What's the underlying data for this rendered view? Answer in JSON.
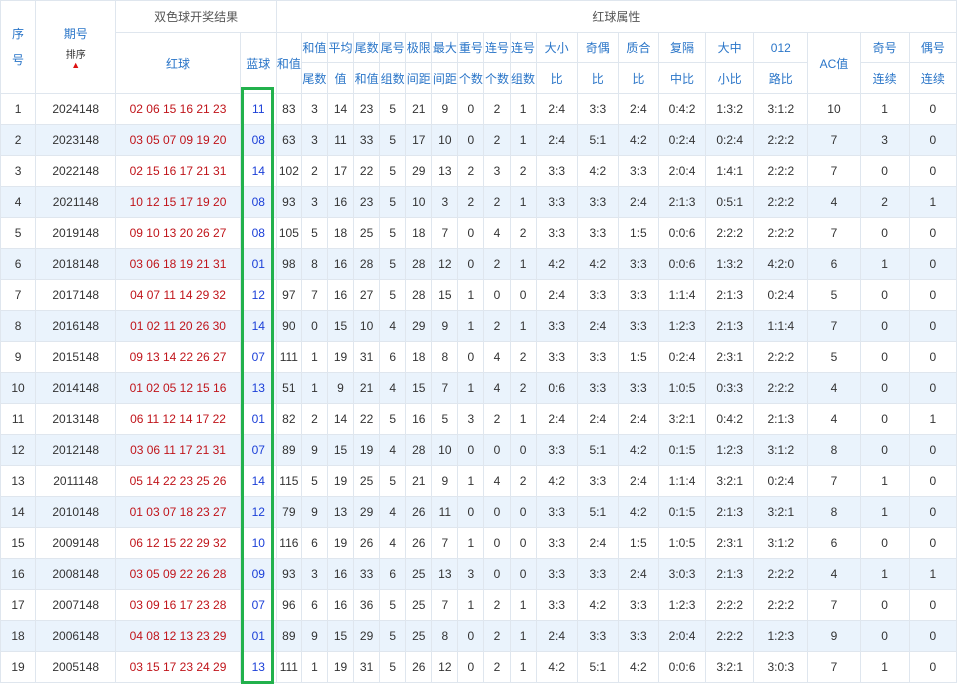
{
  "header": {
    "seq": "序号",
    "period": "期号",
    "sort_label": "排序",
    "group_result": "双色球开奖结果",
    "group_attr": "红球属性",
    "red": "红球",
    "blue": "蓝球",
    "cols": [
      {
        "top": "和值",
        "bottom": "尾数"
      },
      {
        "top": "平均",
        "bottom": "值"
      },
      {
        "top": "尾数",
        "bottom": "和值"
      },
      {
        "top": "尾号",
        "bottom": "组数"
      },
      {
        "top": "极限",
        "bottom": "间距"
      },
      {
        "top": "最大",
        "bottom": "间距"
      },
      {
        "top": "重号",
        "bottom": "个数"
      },
      {
        "top": "连号",
        "bottom": "个数"
      },
      {
        "top": "连号",
        "bottom": "组数"
      },
      {
        "top": "大小",
        "bottom": "比"
      },
      {
        "top": "奇偶",
        "bottom": "比"
      },
      {
        "top": "质合",
        "bottom": "比"
      },
      {
        "top": "复隔",
        "bottom": "中比"
      },
      {
        "top": "大中",
        "bottom": "小比"
      },
      {
        "top": "012",
        "bottom": "路比"
      }
    ],
    "sum": "和值",
    "ac": "AC值",
    "odd_streak": {
      "top": "奇号",
      "bottom": "连续"
    },
    "even_streak": {
      "top": "偶号",
      "bottom": "连续"
    }
  },
  "colors": {
    "red_ball": "#c0141a",
    "blue_ball": "#1b3fd8",
    "header": "#2a75c8",
    "highlight": "#22b14c",
    "row_alt": "#eaf3fc"
  },
  "rows": [
    [
      "1",
      "2024148",
      "02 06 15 16 21 23",
      "11",
      "83",
      "3",
      "14",
      "23",
      "5",
      "21",
      "9",
      "0",
      "2",
      "1",
      "2:4",
      "3:3",
      "2:4",
      "0:4:2",
      "1:3:2",
      "3:1:2",
      "10",
      "1",
      "0"
    ],
    [
      "2",
      "2023148",
      "03 05 07 09 19 20",
      "08",
      "63",
      "3",
      "11",
      "33",
      "5",
      "17",
      "10",
      "0",
      "2",
      "1",
      "2:4",
      "5:1",
      "4:2",
      "0:2:4",
      "0:2:4",
      "2:2:2",
      "7",
      "3",
      "0"
    ],
    [
      "3",
      "2022148",
      "02 15 16 17 21 31",
      "14",
      "102",
      "2",
      "17",
      "22",
      "5",
      "29",
      "13",
      "2",
      "3",
      "2",
      "3:3",
      "4:2",
      "3:3",
      "2:0:4",
      "1:4:1",
      "2:2:2",
      "7",
      "0",
      "0"
    ],
    [
      "4",
      "2021148",
      "10 12 15 17 19 20",
      "08",
      "93",
      "3",
      "16",
      "23",
      "5",
      "10",
      "3",
      "2",
      "2",
      "1",
      "3:3",
      "3:3",
      "2:4",
      "2:1:3",
      "0:5:1",
      "2:2:2",
      "4",
      "2",
      "1"
    ],
    [
      "5",
      "2019148",
      "09 10 13 20 26 27",
      "08",
      "105",
      "5",
      "18",
      "25",
      "5",
      "18",
      "7",
      "0",
      "4",
      "2",
      "3:3",
      "3:3",
      "1:5",
      "0:0:6",
      "2:2:2",
      "2:2:2",
      "7",
      "0",
      "0"
    ],
    [
      "6",
      "2018148",
      "03 06 18 19 21 31",
      "01",
      "98",
      "8",
      "16",
      "28",
      "5",
      "28",
      "12",
      "0",
      "2",
      "1",
      "4:2",
      "4:2",
      "3:3",
      "0:0:6",
      "1:3:2",
      "4:2:0",
      "6",
      "1",
      "0"
    ],
    [
      "7",
      "2017148",
      "04 07 11 14 29 32",
      "12",
      "97",
      "7",
      "16",
      "27",
      "5",
      "28",
      "15",
      "1",
      "0",
      "0",
      "2:4",
      "3:3",
      "3:3",
      "1:1:4",
      "2:1:3",
      "0:2:4",
      "5",
      "0",
      "0"
    ],
    [
      "8",
      "2016148",
      "01 02 11 20 26 30",
      "14",
      "90",
      "0",
      "15",
      "10",
      "4",
      "29",
      "9",
      "1",
      "2",
      "1",
      "3:3",
      "2:4",
      "3:3",
      "1:2:3",
      "2:1:3",
      "1:1:4",
      "7",
      "0",
      "0"
    ],
    [
      "9",
      "2015148",
      "09 13 14 22 26 27",
      "07",
      "111",
      "1",
      "19",
      "31",
      "6",
      "18",
      "8",
      "0",
      "4",
      "2",
      "3:3",
      "3:3",
      "1:5",
      "0:2:4",
      "2:3:1",
      "2:2:2",
      "5",
      "0",
      "0"
    ],
    [
      "10",
      "2014148",
      "01 02 05 12 15 16",
      "13",
      "51",
      "1",
      "9",
      "21",
      "4",
      "15",
      "7",
      "1",
      "4",
      "2",
      "0:6",
      "3:3",
      "3:3",
      "1:0:5",
      "0:3:3",
      "2:2:2",
      "4",
      "0",
      "0"
    ],
    [
      "11",
      "2013148",
      "06 11 12 14 17 22",
      "01",
      "82",
      "2",
      "14",
      "22",
      "5",
      "16",
      "5",
      "3",
      "2",
      "1",
      "2:4",
      "2:4",
      "2:4",
      "3:2:1",
      "0:4:2",
      "2:1:3",
      "4",
      "0",
      "1"
    ],
    [
      "12",
      "2012148",
      "03 06 11 17 21 31",
      "07",
      "89",
      "9",
      "15",
      "19",
      "4",
      "28",
      "10",
      "0",
      "0",
      "0",
      "3:3",
      "5:1",
      "4:2",
      "0:1:5",
      "1:2:3",
      "3:1:2",
      "8",
      "0",
      "0"
    ],
    [
      "13",
      "2011148",
      "05 14 22 23 25 26",
      "14",
      "115",
      "5",
      "19",
      "25",
      "5",
      "21",
      "9",
      "1",
      "4",
      "2",
      "4:2",
      "3:3",
      "2:4",
      "1:1:4",
      "3:2:1",
      "0:2:4",
      "7",
      "1",
      "0"
    ],
    [
      "14",
      "2010148",
      "01 03 07 18 23 27",
      "12",
      "79",
      "9",
      "13",
      "29",
      "4",
      "26",
      "11",
      "0",
      "0",
      "0",
      "3:3",
      "5:1",
      "4:2",
      "0:1:5",
      "2:1:3",
      "3:2:1",
      "8",
      "1",
      "0"
    ],
    [
      "15",
      "2009148",
      "06 12 15 22 29 32",
      "10",
      "116",
      "6",
      "19",
      "26",
      "4",
      "26",
      "7",
      "1",
      "0",
      "0",
      "3:3",
      "2:4",
      "1:5",
      "1:0:5",
      "2:3:1",
      "3:1:2",
      "6",
      "0",
      "0"
    ],
    [
      "16",
      "2008148",
      "03 05 09 22 26 28",
      "09",
      "93",
      "3",
      "16",
      "33",
      "6",
      "25",
      "13",
      "3",
      "0",
      "0",
      "3:3",
      "3:3",
      "2:4",
      "3:0:3",
      "2:1:3",
      "2:2:2",
      "4",
      "1",
      "1"
    ],
    [
      "17",
      "2007148",
      "03 09 16 17 23 28",
      "07",
      "96",
      "6",
      "16",
      "36",
      "5",
      "25",
      "7",
      "1",
      "2",
      "1",
      "3:3",
      "4:2",
      "3:3",
      "1:2:3",
      "2:2:2",
      "2:2:2",
      "7",
      "0",
      "0"
    ],
    [
      "18",
      "2006148",
      "04 08 12 13 23 29",
      "01",
      "89",
      "9",
      "15",
      "29",
      "5",
      "25",
      "8",
      "0",
      "2",
      "1",
      "2:4",
      "3:3",
      "3:3",
      "2:0:4",
      "2:2:2",
      "1:2:3",
      "9",
      "0",
      "0"
    ],
    [
      "19",
      "2005148",
      "03 15 17 23 24 29",
      "13",
      "111",
      "1",
      "19",
      "31",
      "5",
      "26",
      "12",
      "0",
      "2",
      "1",
      "4:2",
      "5:1",
      "4:2",
      "0:0:6",
      "3:2:1",
      "3:0:3",
      "7",
      "1",
      "0"
    ]
  ]
}
